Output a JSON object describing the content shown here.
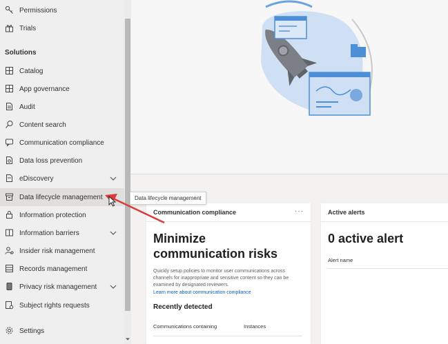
{
  "sidebar": {
    "items_top": [
      {
        "label": "Permissions",
        "icon": "key-icon"
      },
      {
        "label": "Trials",
        "icon": "gift-icon"
      }
    ],
    "section_title": "Solutions",
    "items": [
      {
        "label": "Catalog",
        "icon": "catalog-icon"
      },
      {
        "label": "App governance",
        "icon": "app-governance-icon"
      },
      {
        "label": "Audit",
        "icon": "audit-icon"
      },
      {
        "label": "Content search",
        "icon": "search-icon"
      },
      {
        "label": "Communication compliance",
        "icon": "chat-icon"
      },
      {
        "label": "Data loss prevention",
        "icon": "shield-doc-icon"
      },
      {
        "label": "eDiscovery",
        "icon": "ediscovery-icon"
      },
      {
        "label": "Data lifecycle management",
        "icon": "archive-icon"
      },
      {
        "label": "Information protection",
        "icon": "lock-icon"
      },
      {
        "label": "Information barriers",
        "icon": "barrier-icon"
      },
      {
        "label": "Insider risk management",
        "icon": "person-risk-icon"
      },
      {
        "label": "Records management",
        "icon": "records-icon"
      },
      {
        "label": "Privacy risk management",
        "icon": "privacy-icon"
      },
      {
        "label": "Subject rights requests",
        "icon": "request-icon"
      }
    ],
    "settings_label": "Settings"
  },
  "tooltip": "Data lifecycle management",
  "cards": {
    "communication": {
      "title": "Communication compliance",
      "more": "···",
      "heading_line1": "Minimize",
      "heading_line2": "communication risks",
      "description": "Quickly setup policies to monitor user communications across channels for inappropriate and sensitive content so they can be examined by designated reviewers.",
      "link": "Learn more about communication compliance",
      "recent_heading": "Recently detected",
      "col1": "Communications containing",
      "col2": "Instances"
    },
    "alerts": {
      "title": "Active alerts",
      "heading": "0 active alert",
      "col": "Alert name"
    }
  },
  "colors": {
    "accent": "#0a5fb3",
    "arrow": "#d93b3b",
    "sidebar_bg": "#efefef",
    "hero_blue": "#4d8fd6"
  }
}
